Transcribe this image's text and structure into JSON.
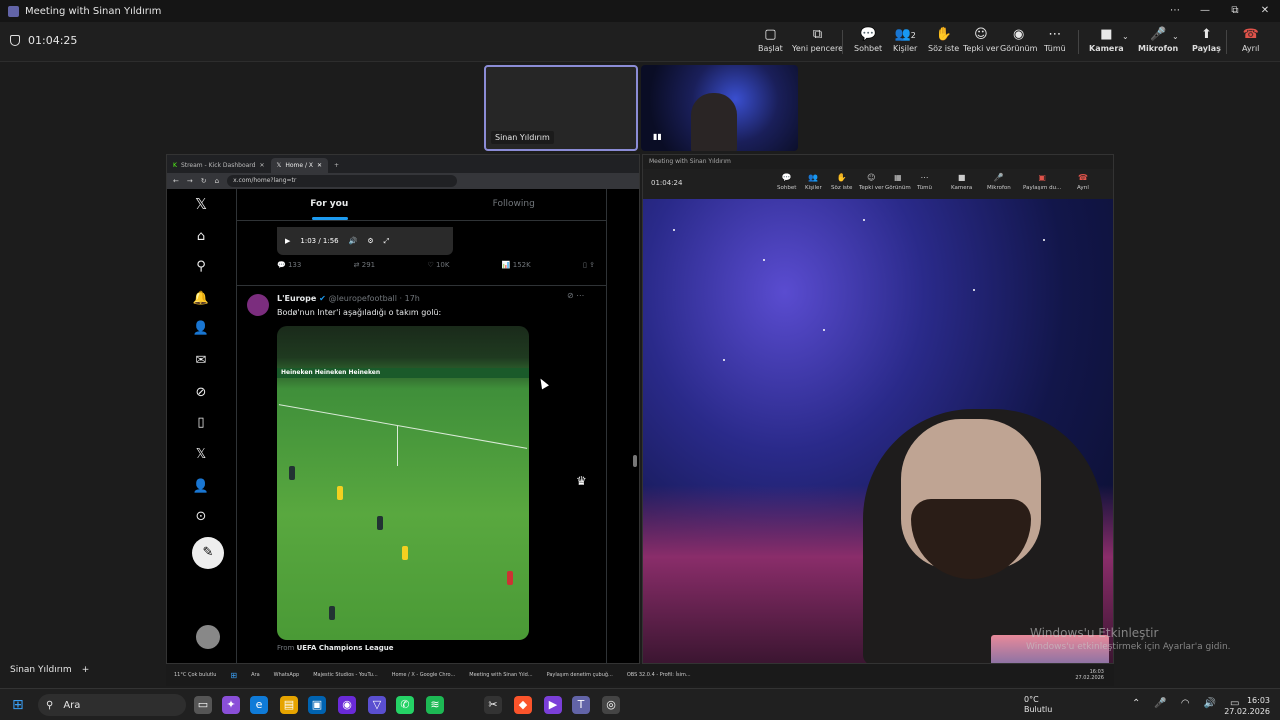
{
  "window": {
    "title": "Meeting with Sinan Yıldırım",
    "controls": [
      "⋯",
      "—",
      "⧉",
      "✕"
    ]
  },
  "meeting": {
    "timer": "01:04:25",
    "toolbar": [
      {
        "label": "Başlat",
        "icon": "▢"
      },
      {
        "label": "Yeni pencere",
        "icon": "⧉"
      },
      {
        "label": "Sohbet",
        "icon": "💬"
      },
      {
        "label": "Kişiler",
        "icon": "👥",
        "count": "2"
      },
      {
        "label": "Söz iste",
        "icon": "✋"
      },
      {
        "label": "Tepki ver",
        "icon": "☺"
      },
      {
        "label": "Görünüm",
        "icon": "◉"
      },
      {
        "label": "Tümü",
        "icon": "⋯"
      },
      {
        "label": "Kamera",
        "icon": "■"
      },
      {
        "label": "Mikrofon",
        "icon": "🎤"
      },
      {
        "label": "Paylaş",
        "icon": "⬆"
      },
      {
        "label": "Ayrıl",
        "icon": "☎"
      }
    ],
    "participant_name": "Sinan Yıldırım",
    "accent_color": "#8b8cd6",
    "leave_color": "#e0534a"
  },
  "browser": {
    "tabs": [
      "Stream - Kick Dashboard",
      "Home / X"
    ],
    "url": "x.com/home?lang=tr",
    "feed_tabs": [
      "For you",
      "Following"
    ],
    "video_time": "1:03 / 1:56",
    "stats": [
      "133",
      "291",
      "10K",
      "152K"
    ],
    "post": {
      "author": "L'Europe",
      "handle": "@leuropefootball · 17h",
      "text": "Bodø'nun Inter'i aşağıladığı o takım golü:",
      "boards": "Heineken          Heineken          Heineken",
      "from_prefix": "From ",
      "from_source": "UEFA Champions League"
    },
    "sidebar_icons": [
      "x-logo-icon",
      "home-icon",
      "search-icon",
      "bell-icon",
      "person-add-icon",
      "mail-icon",
      "grok-icon",
      "bookmark-icon",
      "x-icon",
      "profile-icon",
      "more-icon",
      "post-icon",
      "avatar"
    ]
  },
  "inner_teams": {
    "title": "Meeting with Sinan Yıldırım",
    "timer": "01:04:24",
    "buttons": [
      "Sohbet",
      "Kişiler",
      "Söz iste",
      "Tepki ver",
      "Görünüm",
      "Tümü",
      "Kamera",
      "Mikrofon",
      "Paylaşım du...",
      "Ayrıl"
    ]
  },
  "activation": {
    "line1": "Windows'u Etkinleştir",
    "line2": "Windows'u etkinleştirmek için Ayarlar'a gidin."
  },
  "inner_taskbar": {
    "weather_temp": "11°C",
    "weather_text": "Çok bulutlu",
    "search": "Ara",
    "apps": [
      "WhatsApp",
      "Majestic Studios - YouTu...",
      "Home / X - Google Chro...",
      "Meeting with Sinan Yıld...",
      "Paylaşım denetim çubuğ...",
      "OBS 32.0.4 - Profil: İsim..."
    ],
    "time": "16:03",
    "date": "27.02.2026"
  },
  "left_panel": {
    "name": "Sinan Yıldırım",
    "add": "+"
  },
  "taskbar": {
    "search": "Ara",
    "weather_temp": "0°C",
    "weather_text": "Bulutlu",
    "time": "16:03",
    "date": "27.02.2026"
  }
}
